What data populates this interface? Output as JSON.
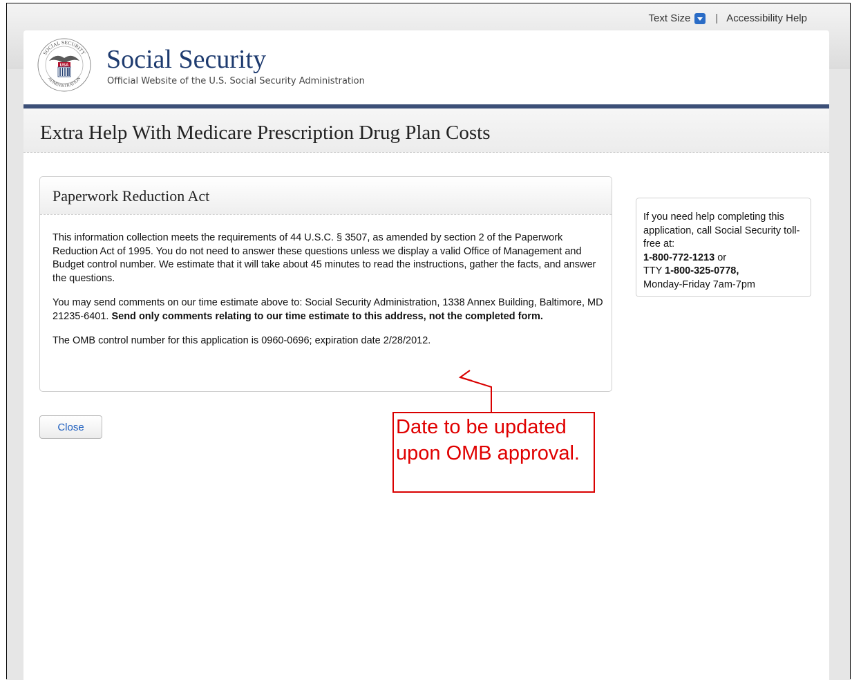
{
  "topbar": {
    "text_size": "Text Size",
    "separator": "|",
    "accessibility": "Accessibility Help"
  },
  "brand": {
    "logo_text_top": "SOCIAL SECURITY",
    "logo_text_usa": "USA",
    "logo_text_bottom": "ADMINISTRATION",
    "title": "Social Security",
    "subtitle": "Official Website of the U.S. Social Security Administration"
  },
  "page": {
    "title": "Extra Help With Medicare Prescription Drug Plan Costs"
  },
  "panel": {
    "title": "Paperwork Reduction Act",
    "para1": "This information collection meets the requirements of 44 U.S.C. § 3507, as amended by section 2 of the Paperwork Reduction Act of 1995. You do not need to answer these questions unless we display a valid Office of Management and Budget control number. We estimate that it will take about 45 minutes to read the instructions, gather the facts, and answer the questions.",
    "para2_normal": "You may send comments on our time estimate above to: Social Security Administration, 1338 Annex Building, Baltimore, MD 21235-6401. ",
    "para2_bold": "Send only comments relating to our time estimate to this address, not the completed form.",
    "para3": "The OMB control number for this application is 0960-0696; expiration date 2/28/2012."
  },
  "help": {
    "intro": "If you need help completing this application, call Social Security toll-free at:",
    "phone": "1-800-772-1213",
    "or": " or",
    "tty_label": "TTY ",
    "tty": "1-800-325-0778,",
    "hours": "Monday-Friday 7am-7pm"
  },
  "actions": {
    "close": "Close"
  },
  "annotation": {
    "text": "Date to be updated upon OMB approval."
  },
  "colors": {
    "brand_navy": "#1e3b6f",
    "rule": "#3c4f77",
    "link": "#1f5fbf",
    "annotation_red": "#d90000"
  }
}
